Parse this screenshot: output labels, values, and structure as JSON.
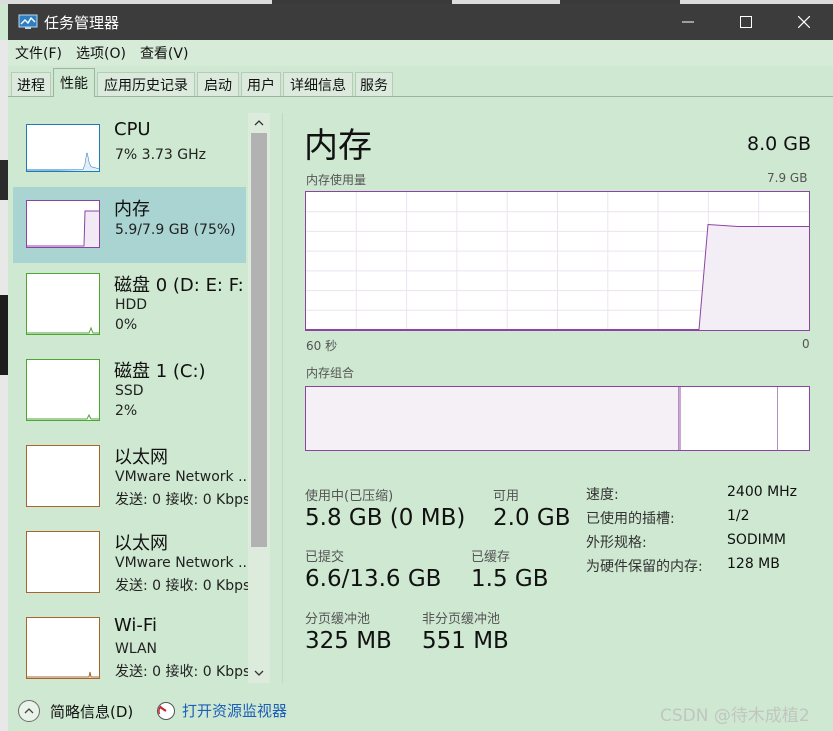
{
  "window": {
    "title": "任务管理器"
  },
  "menu": [
    "文件(F)",
    "选项(O)",
    "查看(V)"
  ],
  "tabs": [
    {
      "label": "进程",
      "active": false
    },
    {
      "label": "性能",
      "active": true
    },
    {
      "label": "应用历史记录",
      "active": false
    },
    {
      "label": "启动",
      "active": false
    },
    {
      "label": "用户",
      "active": false
    },
    {
      "label": "详细信息",
      "active": false
    },
    {
      "label": "服务",
      "active": false
    }
  ],
  "sidebar": {
    "items": [
      {
        "title": "CPU",
        "lines": [
          "7% 3.73 GHz"
        ],
        "selected": false,
        "color": "#1f7ab8"
      },
      {
        "title": "内存",
        "lines": [
          "5.9/7.9 GB (75%)"
        ],
        "selected": true,
        "color": "#8c43a3"
      },
      {
        "title": "磁盘 0 (D: E: F:",
        "lines": [
          "HDD",
          "0%"
        ],
        "selected": false,
        "color": "#4da633"
      },
      {
        "title": "磁盘 1 (C:)",
        "lines": [
          "SSD",
          "2%"
        ],
        "selected": false,
        "color": "#4da633"
      },
      {
        "title": "以太网",
        "lines": [
          "VMware Network ...",
          "发送: 0 接收: 0 Kbps"
        ],
        "selected": false,
        "color": "#a7642b"
      },
      {
        "title": "以太网",
        "lines": [
          "VMware Network ...",
          "发送: 0 接收: 0 Kbps"
        ],
        "selected": false,
        "color": "#a7642b"
      },
      {
        "title": "Wi-Fi",
        "lines": [
          "WLAN",
          "发送: 0 接收: 0 Kbps"
        ],
        "selected": false,
        "color": "#a7642b"
      }
    ]
  },
  "memory": {
    "title": "内存",
    "total": "8.0 GB",
    "usage_label": "内存使用量",
    "usage_max": "7.9 GB",
    "time_left": "60 秒",
    "time_right": "0",
    "composition_label": "内存组合",
    "graph_usage_fraction": 0.75,
    "composition": {
      "used_fraction": 0.74,
      "modified_fraction": 0.005,
      "standby_fraction": 0.19
    },
    "stats": {
      "in_use_label": "使用中(已压缩)",
      "in_use_value": "5.8 GB (0 MB)",
      "available_label": "可用",
      "available_value": "2.0 GB",
      "committed_label": "已提交",
      "committed_value": "6.6/13.6 GB",
      "cached_label": "已缓存",
      "cached_value": "1.5 GB",
      "paged_label": "分页缓冲池",
      "paged_value": "325 MB",
      "nonpaged_label": "非分页缓冲池",
      "nonpaged_value": "551 MB"
    },
    "specs": [
      {
        "key": "速度:",
        "value": "2400 MHz"
      },
      {
        "key": "已使用的插槽:",
        "value": "1/2"
      },
      {
        "key": "外形规格:",
        "value": "SODIMM"
      },
      {
        "key": "为硬件保留的内存:",
        "value": "128 MB"
      }
    ]
  },
  "footer": {
    "summary_label": "简略信息(D)",
    "monitor_label": "打开资源监视器",
    "watermark": "CSDN @待木成植2"
  },
  "colors": {
    "accent_memory": "#8c43a3",
    "background": "#cfe8d1",
    "link": "#1b5fb8"
  }
}
